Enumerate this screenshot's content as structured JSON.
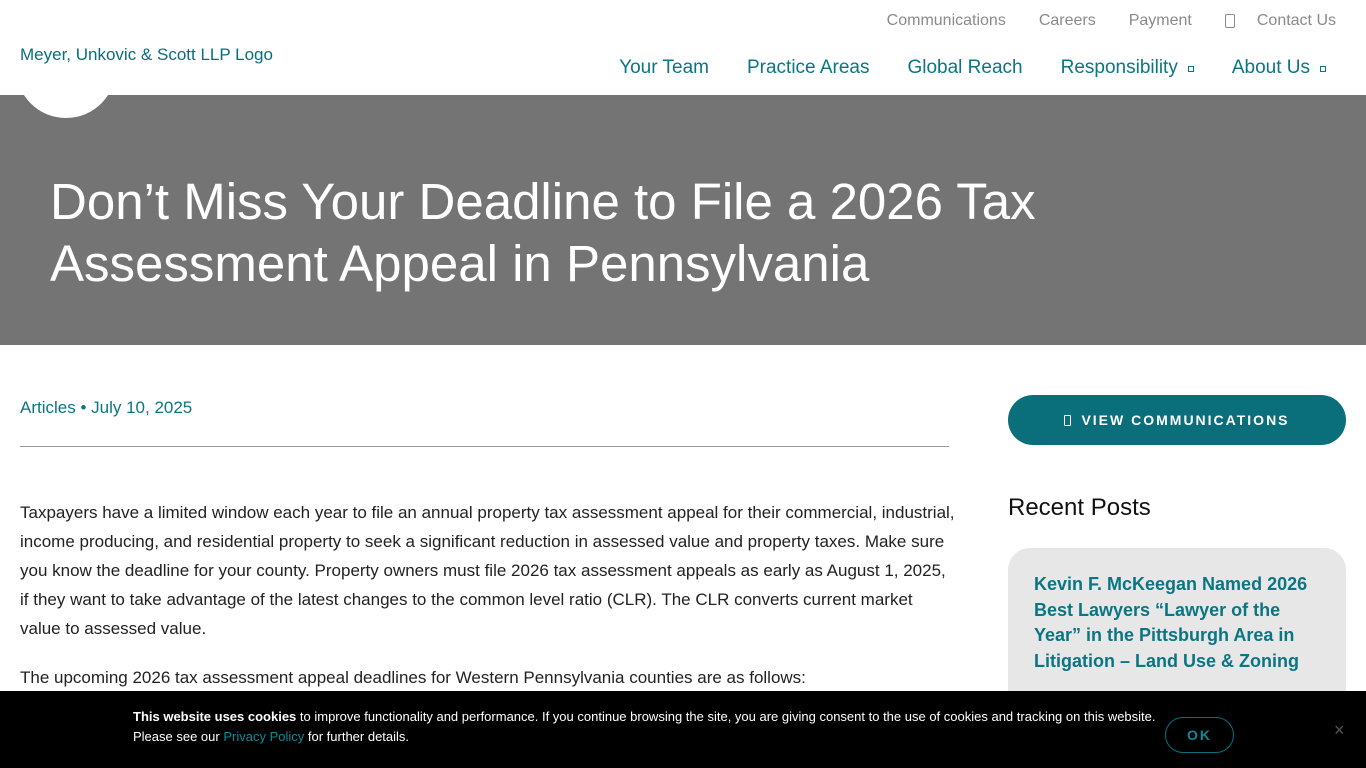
{
  "header": {
    "logo_alt": "Meyer, Unkovic & Scott LLP Logo",
    "top_links": [
      "Communications",
      "Careers",
      "Payment",
      "Contact Us"
    ],
    "nav": [
      {
        "label": "Your Team"
      },
      {
        "label": "Practice Areas"
      },
      {
        "label": "Global Reach"
      },
      {
        "label": "Responsibility"
      },
      {
        "label": "About Us"
      }
    ]
  },
  "hero": {
    "title": "Don’t Miss Your Deadline to File a 2026 Tax Assessment Appeal in Pennsylvania"
  },
  "article": {
    "meta": "Articles • July 10, 2025",
    "paragraphs": [
      "Taxpayers have a limited window each year to file an annual property tax assessment appeal for their commercial, industrial, income producing, and residential property to seek a significant reduction in assessed value and property taxes. Make sure you know the deadline for your county. Property owners must file 2026 tax assessment appeals as early as August 1, 2025, if they want to take advantage of the latest changes to the common level ratio (CLR). The CLR converts current market value to assessed value.",
      "The upcoming 2026 tax assessment appeal deadlines for Western Pennsylvania counties are as follows:"
    ]
  },
  "sidebar": {
    "view_button": "VIEW COMMUNICATIONS",
    "recent_title": "Recent Posts",
    "recent_posts": [
      "Kevin F. McKeegan Named 2026 Best Lawyers “Lawyer of the Year” in the Pittsburgh Area in Litigation – Land Use & Zoning"
    ]
  },
  "cookie": {
    "bold": "This website uses cookies",
    "text1": " to improve functionality and performance. If you continue browsing the site, you are giving consent to the use of cookies and tracking on this website. Please see our ",
    "link": "Privacy Policy",
    "text2": " for further details.",
    "ok_label": "OK",
    "close_label": "×"
  },
  "colors": {
    "accent": "#0b7583",
    "hero_bg": "#747474",
    "card_bg": "#e7e7e7"
  }
}
